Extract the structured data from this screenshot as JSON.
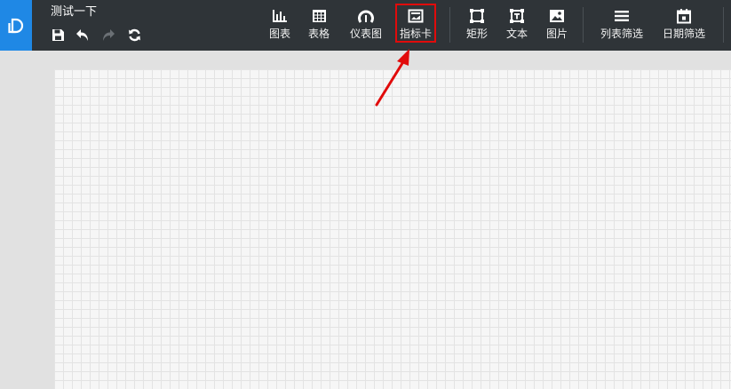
{
  "header": {
    "title": "测试一下"
  },
  "quick_actions": [
    {
      "name": "save-icon",
      "label": "save"
    },
    {
      "name": "undo-icon",
      "label": "undo"
    },
    {
      "name": "redo-icon",
      "label": "redo"
    },
    {
      "name": "refresh-icon",
      "label": "refresh"
    }
  ],
  "toolbar": {
    "chart_label": "图表",
    "table_label": "表格",
    "gauge_label": "仪表图",
    "kpi_card_label": "指标卡",
    "rectangle_label": "矩形",
    "text_label": "文本",
    "image_label": "图片",
    "list_filter_label": "列表筛选",
    "date_filter_label": "日期筛选"
  },
  "colors": {
    "topbar": "#2f3438",
    "logo_bg": "#1f88e5",
    "highlight": "#e10b0b",
    "canvas": "#f6f6f6",
    "grid_line": "#e3e3e3",
    "workspace": "#e1e1e1"
  }
}
